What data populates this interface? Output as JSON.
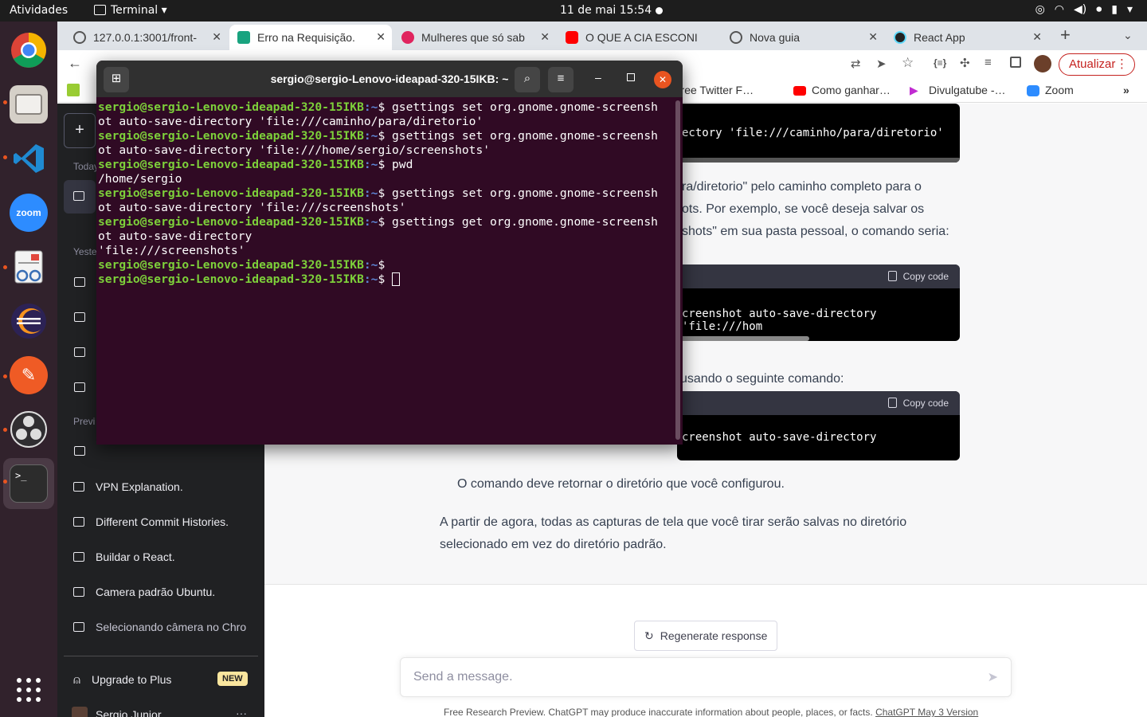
{
  "topbar": {
    "activities": "Atividades",
    "app_menu": "Terminal ▾",
    "clock": "11 de mai  15:54"
  },
  "tabs": [
    {
      "label": "127.0.0.1:3001/front-",
      "color": "#555"
    },
    {
      "label": "Erro na Requisição.",
      "color": "#19a37f"
    },
    {
      "label": "Mulheres que só sab",
      "color": "#e0245e"
    },
    {
      "label": "O QUE A CIA ESCONI",
      "color": "#ff0000"
    },
    {
      "label": "Nova guia",
      "color": "#555"
    },
    {
      "label": "React App",
      "color": "#61dafb"
    }
  ],
  "toolbar": {
    "update_button": "Atualizar"
  },
  "bookmarks": [
    {
      "label": "Free Twitter F…"
    },
    {
      "label": "Como ganhar…"
    },
    {
      "label": "Divulgatube -…"
    },
    {
      "label": "Zoom"
    }
  ],
  "sidebar": {
    "new_chat": "+",
    "today_label": "Today",
    "yesterday_label": "Yeste",
    "previous_label": "Previ",
    "history": [
      {
        "label": "VPN Explanation."
      },
      {
        "label": "Different Commit Histories."
      },
      {
        "label": "Buildar o React."
      },
      {
        "label": "Camera padrão Ubuntu."
      },
      {
        "label": "Selecionando câmera no Chro"
      }
    ],
    "upgrade_label": "Upgrade to Plus",
    "new_badge": "NEW",
    "user_name": "Sergio Junior",
    "user_menu": "···"
  },
  "chat": {
    "code1": "ectory 'file:///caminho/para/diretorio'",
    "para1_lines": [
      "ra/diretorio\" pelo caminho completo para o",
      "ots. Por exemplo, se você deseja salvar os",
      "shots\" em sua pasta pessoal, o comando seria:"
    ],
    "copy_label": "Copy code",
    "code2": "creenshot auto-save-directory 'file:///hom",
    "para2": "usando o seguinte comando:",
    "code3": "creenshot auto-save-directory",
    "para3": "O comando deve retornar o diretório que você configurou.",
    "para4_lines": [
      "A partir de agora, todas as capturas de tela que você tirar serão salvas no diretório",
      "selecionado em vez do diretório padrão."
    ],
    "regenerate": "Regenerate response",
    "input_placeholder": "Send a message.",
    "footer": "Free Research Preview. ChatGPT may produce inaccurate information about people, places, or facts.",
    "footer_link": "ChatGPT May 3 Version"
  },
  "terminal": {
    "title": "sergio@sergio-Lenovo-ideapad-320-15IKB: ~",
    "prompt": "sergio@sergio-Lenovo-ideapad-320-15IKB",
    "path": ":~",
    "lines": [
      {
        "type": "cmd",
        "text": "$ gsettings set org.gnome.gnome-screensh"
      },
      {
        "type": "out",
        "text": "ot auto-save-directory 'file:///caminho/para/diretorio'"
      },
      {
        "type": "cmd",
        "text": "$ gsettings set org.gnome.gnome-screensh"
      },
      {
        "type": "out",
        "text": "ot auto-save-directory 'file:///home/sergio/screenshots'"
      },
      {
        "type": "cmd",
        "text": "$ pwd"
      },
      {
        "type": "out",
        "text": "/home/sergio"
      },
      {
        "type": "cmd",
        "text": "$ gsettings set org.gnome.gnome-screensh"
      },
      {
        "type": "out",
        "text": "ot auto-save-directory 'file:///screenshots'"
      },
      {
        "type": "cmd",
        "text": "$ gsettings get org.gnome.gnome-screensh"
      },
      {
        "type": "out",
        "text": "ot auto-save-directory"
      },
      {
        "type": "out",
        "text": "'file:///screenshots'"
      },
      {
        "type": "cmd",
        "text": "$"
      },
      {
        "type": "cmd",
        "text": "$ "
      }
    ]
  }
}
